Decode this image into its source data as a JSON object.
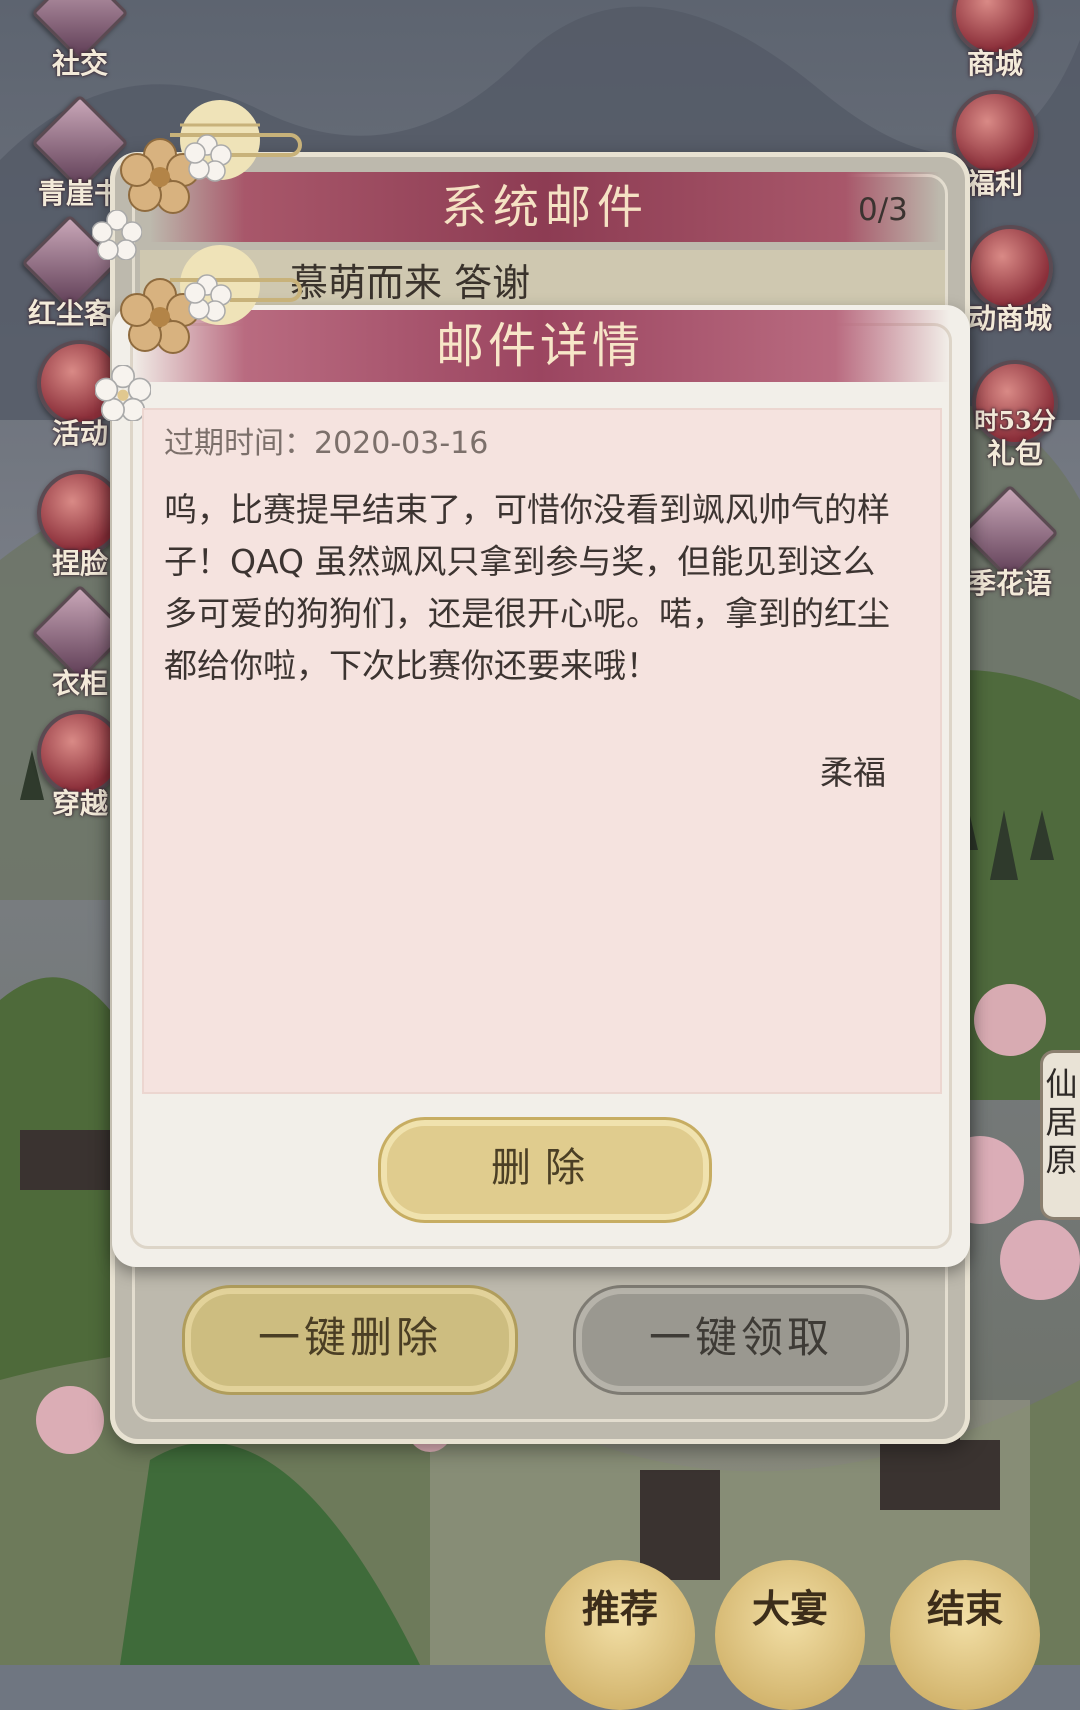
{
  "sidebar_left": [
    {
      "label": "社交",
      "icon": "chat-icon"
    },
    {
      "label": "青崖书",
      "icon": "book-icon"
    },
    {
      "label": "红尘客",
      "icon": "crane-icon"
    },
    {
      "label": "活动",
      "icon": "fan-icon"
    },
    {
      "label": "捏脸",
      "icon": "face-icon"
    },
    {
      "label": "衣柜",
      "icon": "wardrobe-icon"
    },
    {
      "label": "穿越",
      "icon": "portal-icon"
    }
  ],
  "sidebar_right": [
    {
      "label": "商城",
      "icon": "shop-icon"
    },
    {
      "label": "福利",
      "icon": "welfare-icon"
    },
    {
      "label": "动商城",
      "icon": "event-shop-icon"
    },
    {
      "label": "礼包",
      "icon": "gift-icon",
      "timer": "时53分"
    },
    {
      "label": "季花语",
      "icon": "flower-book-icon"
    }
  ],
  "side_plaque": "仙居原",
  "system_mail": {
    "title": "系统邮件",
    "count": "0/3",
    "item_title": "慕萌而来 答谢",
    "delete_all_label": "一键删除",
    "claim_all_label": "一键领取"
  },
  "mail_detail": {
    "title": "邮件详情",
    "expire": "过期时间：2020-03-16",
    "body": "呜，比赛提早结束了，可惜你没看到飒风帅气的样子！QAQ 虽然飒风只拿到参与奖，但能见到这么多可爱的狗狗们，还是很开心呢。喏，拿到的红尘都给你啦，下次比赛你还要来哦！",
    "signature": "柔福",
    "delete_label": "删除"
  },
  "bottom_nav": [
    {
      "label": "推荐"
    },
    {
      "label": "大宴"
    },
    {
      "label": "结束"
    }
  ],
  "colors": {
    "header_accent": "#9b4560",
    "button_gold": "#e0cc8e",
    "button_gray": "#9a9890",
    "content_bg": "#f5e3df"
  }
}
